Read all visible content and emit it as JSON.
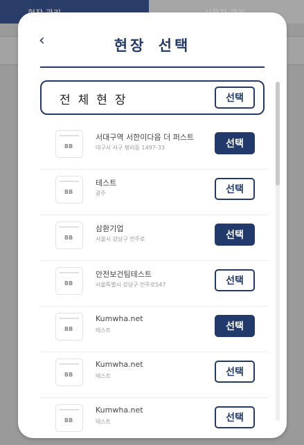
{
  "background": {
    "tab_left": "현장 관리",
    "tab_right": "사용자 관리"
  },
  "modal": {
    "title": "현장 선택",
    "back_icon": "‹",
    "all_sites_label": "전체현장",
    "all_sites_button": "선택",
    "sites": [
      {
        "name": "서대구역 서한이다음 더 퍼스트",
        "address": "대구시 서구 평리동 1497-33",
        "button": "선택",
        "selected": true
      },
      {
        "name": "테스트",
        "address": "광주",
        "button": "선택",
        "selected": false
      },
      {
        "name": "삼환기업",
        "address": "서울시 강남구 언주로",
        "button": "선택",
        "selected": true
      },
      {
        "name": "안전보건팀테스트",
        "address": "서울특별시 강남구 언주로547",
        "button": "선택",
        "selected": false
      },
      {
        "name": "Kumwha.net",
        "address": "테스트",
        "button": "선택",
        "selected": true
      },
      {
        "name": "Kumwha.net",
        "address": "테스트",
        "button": "선택",
        "selected": false
      },
      {
        "name": "Kumwha.net",
        "address": "테스트",
        "button": "선택",
        "selected": false
      }
    ],
    "thumb_label": "BB"
  },
  "colors": {
    "accent": "#223a6b"
  }
}
